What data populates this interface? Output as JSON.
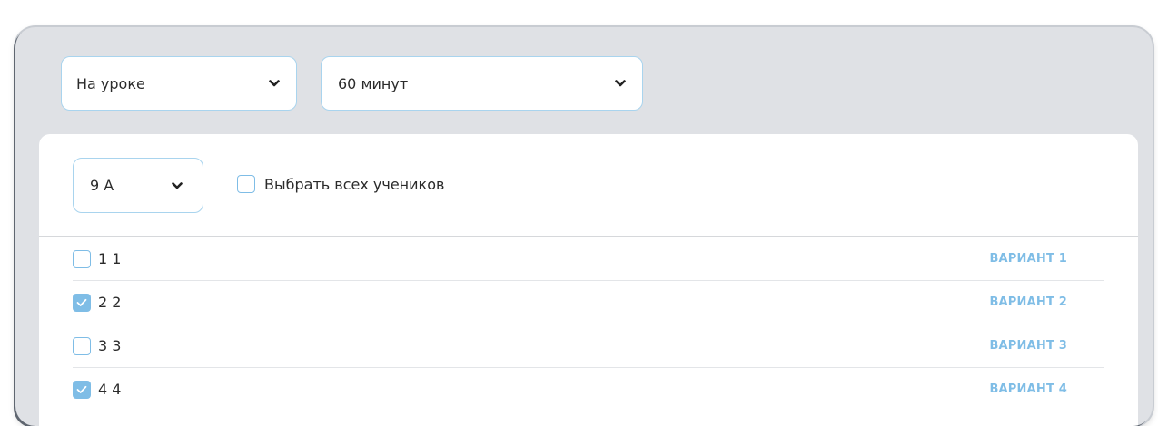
{
  "filters": {
    "mode": "На уроке",
    "duration": "60 минут"
  },
  "panel": {
    "class_select": "9 А",
    "select_all_label": "Выбрать всех учеников"
  },
  "students": [
    {
      "name": "1 1",
      "checked": false,
      "variant": "ВАРИАНТ 1"
    },
    {
      "name": "2 2",
      "checked": true,
      "variant": "ВАРИАНТ 2"
    },
    {
      "name": "3 3",
      "checked": false,
      "variant": "ВАРИАНТ 3"
    },
    {
      "name": "4 4",
      "checked": true,
      "variant": "ВАРИАНТ 4"
    }
  ],
  "colors": {
    "accent": "#7fbde6",
    "frame_bg": "#dfe1e5",
    "select_border": "#a9d4ee"
  }
}
